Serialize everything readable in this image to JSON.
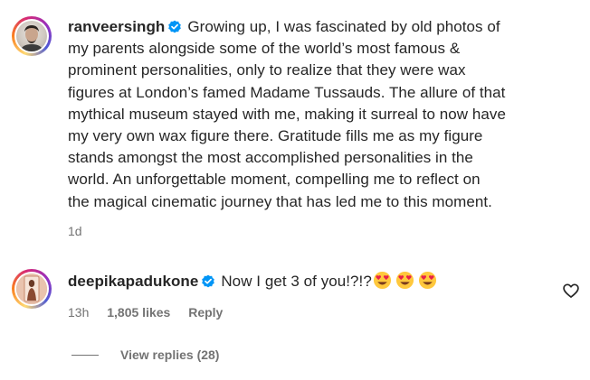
{
  "comments": [
    {
      "username": "ranveersingh",
      "lines": [
        "Growing up, I was fascinated by old photos of",
        "my parents alongside some of the world’s most famous &",
        "prominent personalities, only to realize that they were wax",
        "figures at London’s famed Madame Tussauds. The allure of that",
        "mythical museum stayed with me, making it surreal to now have",
        "my very own wax figure there. Gratitude fills me as my figure",
        "stands amongst the most accomplished personalities in the",
        "world. An unforgettable moment, compelling me to reflect on",
        "the magical cinematic journey that has led me to this moment."
      ],
      "time": "1d"
    },
    {
      "username": "deepikapadukone",
      "text": "Now I get 3 of you!?!?",
      "emoji_count": 3,
      "time": "13h",
      "likes": "1,805 likes",
      "reply_label": "Reply"
    }
  ],
  "view_replies": "View replies (28)",
  "icons": {
    "verified": "verified-badge-icon",
    "emoji": "smiling-face-with-heart-eyes",
    "like": "heart-outline-icon"
  },
  "colors": {
    "verified": "#0095f6",
    "muted": "#737373",
    "text": "#262626"
  }
}
